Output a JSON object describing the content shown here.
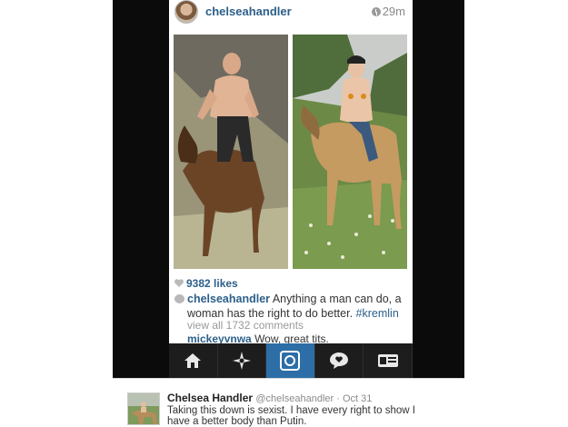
{
  "post": {
    "username": "chelseahandler",
    "time_ago": "29m",
    "likes": "9382 likes",
    "caption_user": "chelseahandler",
    "caption_text": "Anything a man can do, a",
    "caption_text_2": "woman has the right to do better.",
    "caption_tag": "#kremlin",
    "view_all": "view all 1732 comments",
    "comment_user": "mickeyvnwa",
    "comment_text": "Wow, great tits."
  },
  "nav": {
    "items": [
      "home-icon",
      "explore-icon",
      "camera-icon",
      "activity-icon",
      "profile-icon"
    ],
    "active_index": 2,
    "active_color": "#2d6ea6"
  },
  "tweet": {
    "name": "Chelsea Handler",
    "handle": "@chelseahandler",
    "date": "Oct 31",
    "text": "Taking this down is sexist. I have every right to show I have a better body than Putin."
  },
  "colors": {
    "link": "#2c5f8a",
    "frame": "#0b0b0b"
  }
}
